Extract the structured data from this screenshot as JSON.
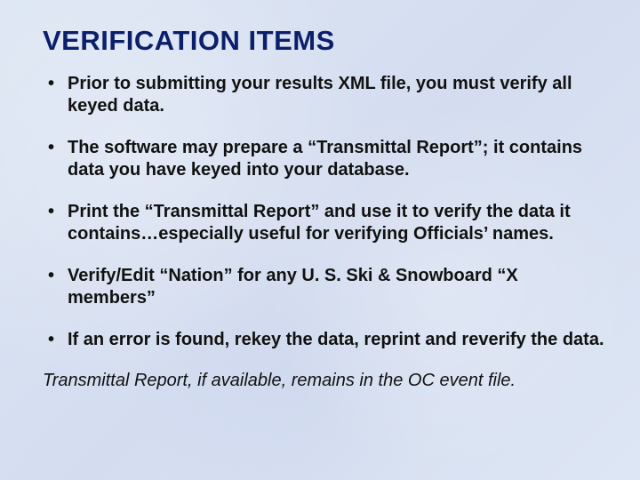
{
  "title": "VERIFICATION ITEMS",
  "bullets": [
    "Prior to submitting your results XML file, you must verify all keyed data.",
    "The software may prepare a “Transmittal Report”; it contains data you have keyed into your database.",
    "Print the “Transmittal Report” and use it to verify the data it contains…especially useful for verifying Officials’ names.",
    "Verify/Edit “Nation” for any U. S. Ski & Snowboard “X members”",
    "If an error is found, rekey the data, reprint and reverify the data."
  ],
  "footer": "Transmittal Report, if available, remains in the OC event file."
}
